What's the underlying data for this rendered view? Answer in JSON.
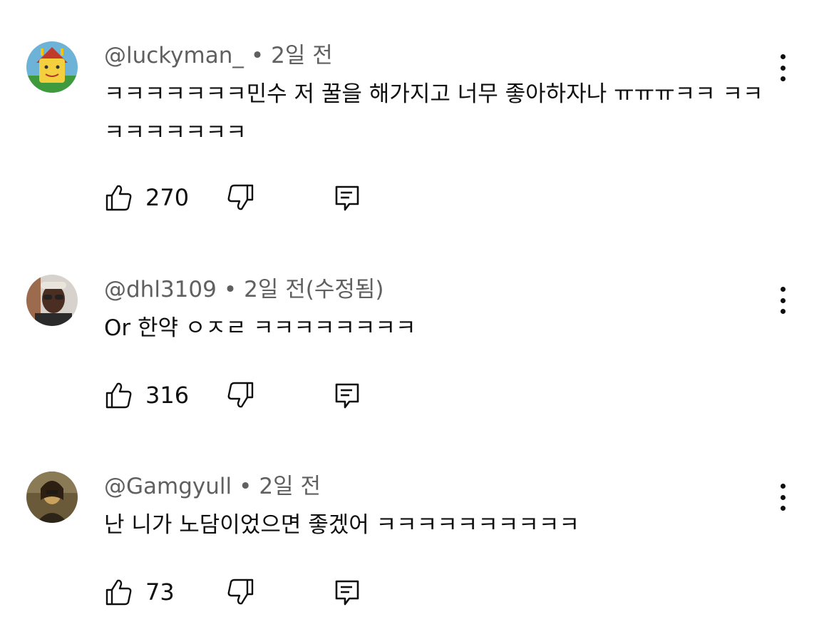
{
  "comments": [
    {
      "handle": "@luckyman_",
      "time": "2일 전",
      "text": "ㅋㅋㅋㅋㅋㅋㅋ민수 저 꿀을 해가지고 너무 좋아하자나 ㅠㅠㅠㅋㅋ ㅋㅋㅋㅋㅋㅋㅋㅋㅋ",
      "likes": "270",
      "avatar_icon": "cartoon-face-avatar"
    },
    {
      "handle": "@dhl3109",
      "time": "2일 전(수정됨)",
      "text": "Or 한약 ㅇㅈㄹ ㅋㅋㅋㅋㅋㅋㅋㅋ",
      "likes": "316",
      "avatar_icon": "person-photo-avatar"
    },
    {
      "handle": "@Gamgyull",
      "time": "2일 전",
      "text": "난 니가 노담이었으면 좋겠어 ㅋㅋㅋㅋㅋㅋㅋㅋㅋㅋ",
      "likes": "73",
      "avatar_icon": "painting-avatar"
    }
  ],
  "icons": {
    "like": "thumbs-up-icon",
    "dislike": "thumbs-down-icon",
    "reply": "reply-comment-icon",
    "more": "more-vertical-icon"
  },
  "colors": {
    "text": "#0f0f0f",
    "meta": "#606060",
    "background": "#ffffff"
  }
}
